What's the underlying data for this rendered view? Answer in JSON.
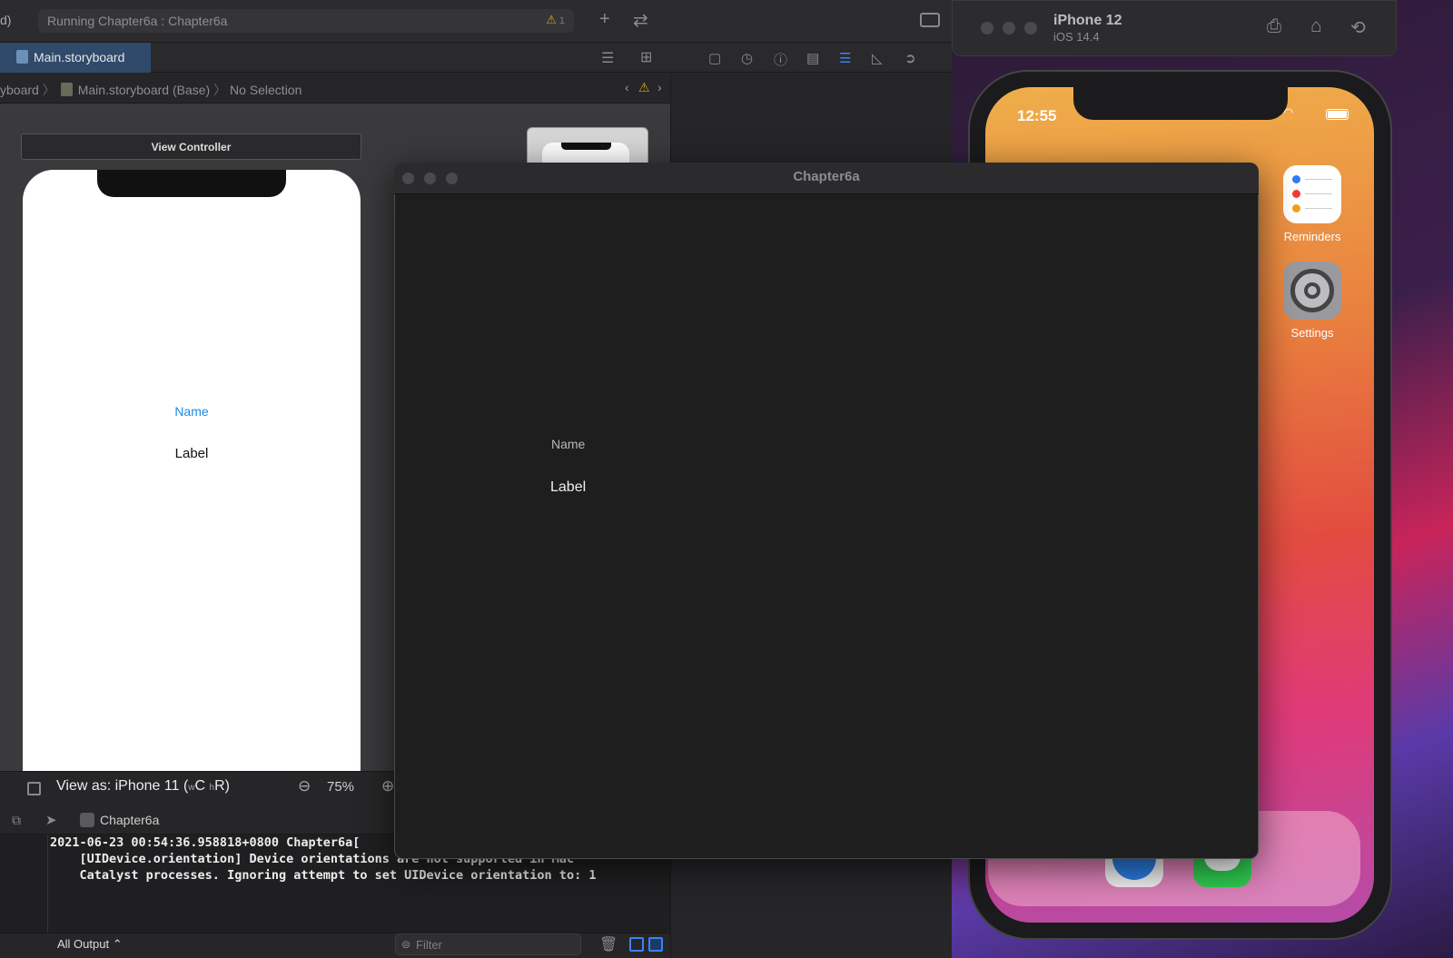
{
  "xcode": {
    "toolbar": {
      "scheme_fragment": "d)",
      "activity_text": "Running Chapter6a : Chapter6a",
      "warning_count": "1"
    },
    "tab": {
      "label": "Main.storyboard"
    },
    "jumpbar": {
      "crumb_1": "yboard",
      "crumb_2": "Main.storyboard (Base)",
      "crumb_3": "No Selection"
    },
    "storyboard": {
      "scene_title": "View Controller",
      "name_text": "Name",
      "label_text": "Label"
    },
    "canvas_bar": {
      "view_as": "View as: iPhone 11 (",
      "size_class_w": "w",
      "size_class_w_val": "C",
      "size_class_h": "h",
      "size_class_h_val": "R)",
      "zoom": "75%"
    },
    "debug": {
      "target": "Chapter6a",
      "console_lines": "2021-06-23 00:54:36.958818+0800 Chapter6a[\n    [UIDevice.orientation] Device orientations are not supported in Mac\n    Catalyst processes. Ignoring attempt to set UIDevice orientation to: 1",
      "output_selector": "All Output ⌃",
      "filter_placeholder": "Filter"
    }
  },
  "simulator": {
    "device_name": "iPhone 12",
    "os_version": "iOS 14.4",
    "time": "12:55",
    "apps": [
      {
        "label": "Reminders",
        "icon": "reminders-icon"
      },
      {
        "label": "Settings",
        "icon": "settings-icon"
      }
    ]
  },
  "catalyst_window": {
    "title": "Chapter6a",
    "name_text": "Name",
    "label_text": "Label"
  }
}
